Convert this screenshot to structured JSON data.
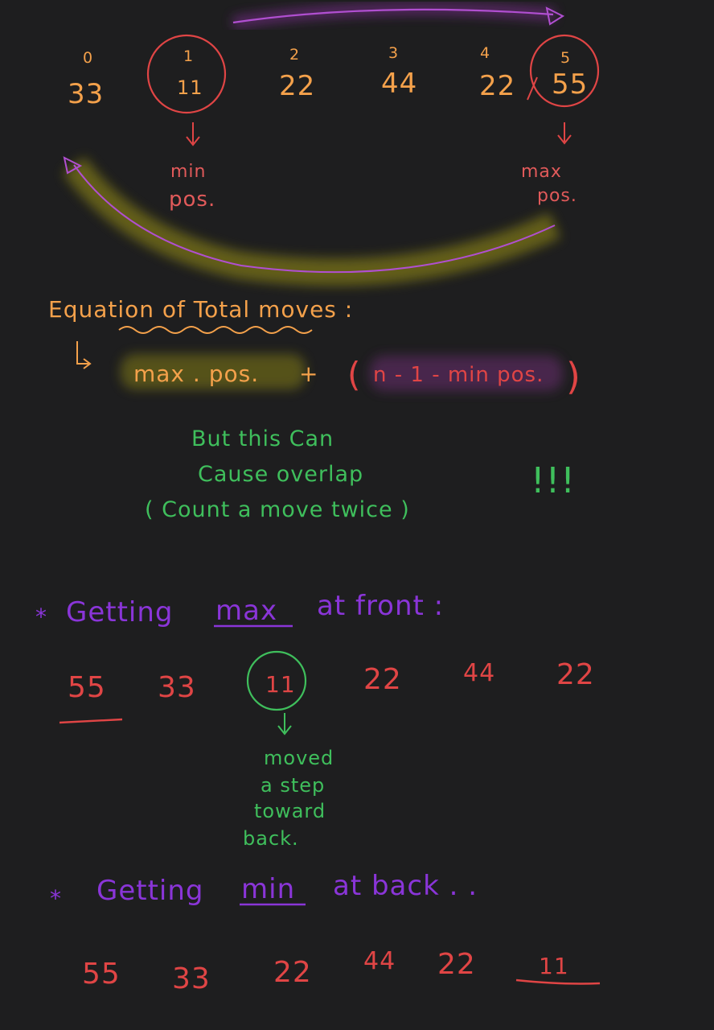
{
  "top_array": {
    "indices": [
      "0",
      "1",
      "2",
      "3",
      "4",
      "5"
    ],
    "values": [
      "33",
      "11",
      "22",
      "44",
      "22",
      "55"
    ]
  },
  "labels": {
    "min": "min",
    "min_pos": "pos.",
    "max": "max",
    "max_pos": "pos."
  },
  "equation": {
    "heading": "Equation of Total moves :",
    "part_max": "max . pos.",
    "plus": "+",
    "part_min": "n - 1 - min pos."
  },
  "warning": {
    "line1": "But this Can",
    "line2": "Cause overlap",
    "line3": "( Count a move twice )",
    "exclaim": "!!!"
  },
  "section_front": {
    "star": "*",
    "title_a": "Getting",
    "title_max": "max",
    "title_b": "at front :",
    "values": [
      "55",
      "33",
      "11",
      "22",
      "44",
      "22"
    ]
  },
  "moved_note": {
    "l1": "moved",
    "l2": "a step",
    "l3": "toward",
    "l4": "back."
  },
  "section_back": {
    "star": "*",
    "title_a": "Getting",
    "title_min": "min",
    "title_b": "at back . .",
    "values": [
      "55",
      "33",
      "22",
      "44",
      "22",
      "11"
    ]
  },
  "colors": {
    "background": "#1e1e1f",
    "orange": "#f4a14b",
    "red": "#e04545",
    "green": "#3fbf5c",
    "purple": "#8a35d8",
    "highlight": "#b8b418"
  }
}
